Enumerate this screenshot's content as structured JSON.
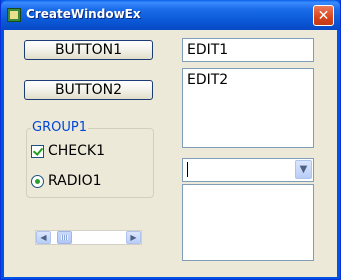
{
  "window": {
    "title": "CreateWindowEx",
    "close_glyph": "✕"
  },
  "buttons": [
    {
      "label": "BUTTON1"
    },
    {
      "label": "BUTTON2"
    }
  ],
  "group": {
    "label": "GROUP1",
    "checkbox": {
      "label": "CHECK1",
      "checked": true
    },
    "radio": {
      "label": "RADIO1",
      "selected": true
    }
  },
  "edits": [
    {
      "value": "EDIT1"
    },
    {
      "value": "EDIT2"
    }
  ],
  "combobox": {
    "value": ""
  },
  "scrollbar": {
    "left_glyph": "◀",
    "right_glyph": "▶",
    "position": 0.1
  },
  "colors": {
    "title_bar": "#0a58d6",
    "client_bg": "#ece9d8",
    "group_label": "#0046d5",
    "close_button": "#d9451c"
  },
  "icons": [
    "app-icon",
    "close-icon",
    "check-icon",
    "radio-dot-icon",
    "scroll-left-icon",
    "scroll-right-icon",
    "dropdown-arrow-icon"
  ]
}
